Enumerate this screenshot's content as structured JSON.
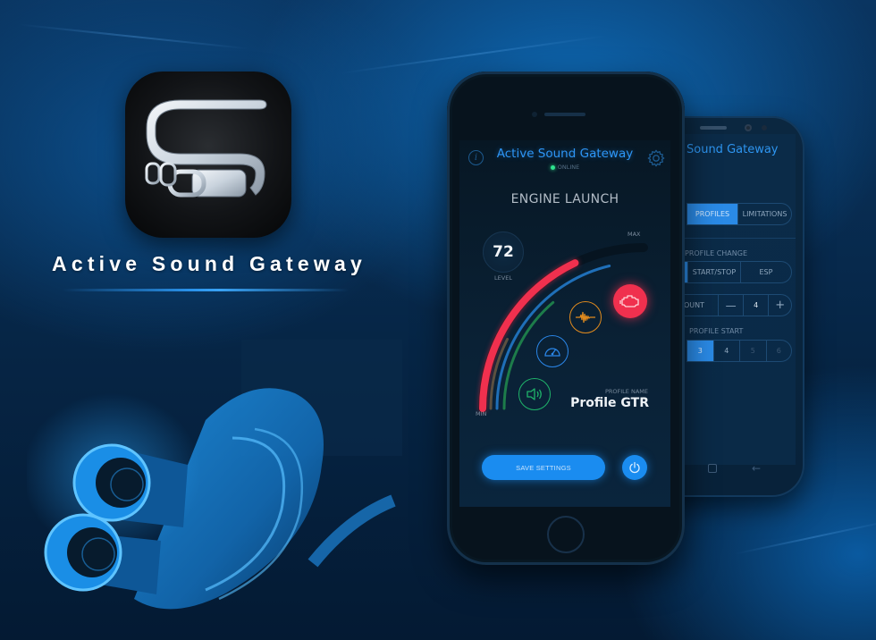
{
  "branding": {
    "app_name": "Active Sound Gateway",
    "icon": "s-exhaust-logo-icon"
  },
  "front_phone": {
    "header": {
      "title": "Active Sound Gateway",
      "status": "ONLINE",
      "status_color": "#2ee38e",
      "info_icon": "info-icon",
      "settings_icon": "gear-icon"
    },
    "heading": "ENGINE LAUNCH",
    "gauge": {
      "level_value": "72",
      "level_label": "LEVEL",
      "max_label": "MAX",
      "min_label": "MIN",
      "level_percent": 72,
      "track_colors": {
        "main": "#f0304e",
        "blue": "#1f6fb8",
        "green": "#1d7c4a",
        "brown": "#5c5040"
      }
    },
    "modes": [
      {
        "name": "engine",
        "icon": "engine-check-icon",
        "color": "#f0304e",
        "active": true
      },
      {
        "name": "sound-wave",
        "icon": "sound-wave-icon",
        "color": "#e08a1e",
        "active": false
      },
      {
        "name": "speedometer",
        "icon": "speedometer-icon",
        "color": "#2a86e8",
        "active": false
      },
      {
        "name": "speaker",
        "icon": "speaker-icon",
        "color": "#1fb36a",
        "active": false
      }
    ],
    "profile": {
      "label": "PROFILE NAME",
      "name": "Profile GTR"
    },
    "save_button": "SAVE SETTINGS",
    "power_icon": "power-icon"
  },
  "back_phone": {
    "title": "Sound Gateway",
    "tabs": [
      {
        "label": "PROFILES",
        "active": true
      },
      {
        "label": "LIMITATIONS",
        "active": false
      }
    ],
    "profile_change": {
      "label": "PROFILE CHANGE",
      "options": [
        {
          "label": "",
          "active": true
        },
        {
          "label": "START/STOP",
          "active": false
        },
        {
          "label": "ESP",
          "active": false
        }
      ]
    },
    "count": {
      "label": "OUNT",
      "minus": "—",
      "value": "4",
      "plus": "+"
    },
    "profile_start": {
      "label": "PROFILE START",
      "options": [
        {
          "label": "3",
          "active": true
        },
        {
          "label": "4",
          "active": false
        },
        {
          "label": "5",
          "active": false
        },
        {
          "label": "6",
          "active": false
        }
      ]
    },
    "nav": {
      "home_icon": "square-home-icon",
      "back_icon": "arrow-left-icon"
    }
  }
}
